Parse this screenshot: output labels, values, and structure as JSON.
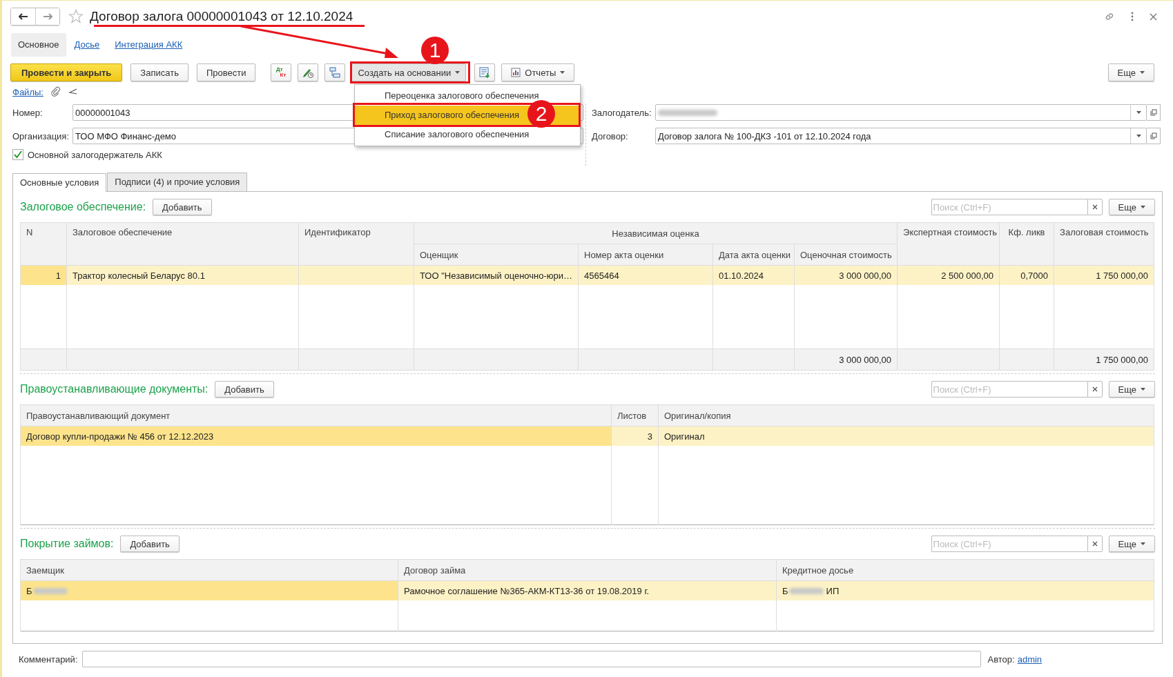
{
  "window": {
    "title": "Договор залога 00000001043 от 12.10.2024"
  },
  "nav_tabs": [
    {
      "label": "Основное",
      "selected": true
    },
    {
      "label": "Досье",
      "selected": false
    },
    {
      "label": "Интеграция АКК",
      "selected": false
    }
  ],
  "toolbar": {
    "buttons": [
      {
        "kind": "primary",
        "label": "Провести и закрыть"
      },
      {
        "kind": "plain",
        "label": "Записать"
      },
      {
        "kind": "plain",
        "label": "Провести"
      },
      {
        "kind": "dtkt",
        "top": "Дт",
        "bottom": "Кт"
      },
      {
        "kind": "pen"
      },
      {
        "kind": "struct"
      },
      {
        "kind": "menu",
        "label": "Создать на основании",
        "expanded": true
      },
      {
        "kind": "doc"
      },
      {
        "kind": "reports",
        "label": "Отчеты"
      }
    ],
    "more": "Еще"
  },
  "create_menu": [
    {
      "label": "Переоценка залогового обеспечения",
      "selected": false
    },
    {
      "label": "Приход залогового обеспечения",
      "selected": true
    },
    {
      "label": "Списание залогового обеспечения",
      "selected": false
    }
  ],
  "files_link": "Файлы:",
  "fields_left": [
    {
      "label": "Номер:",
      "value": "00000001043"
    },
    {
      "label": "Организация:",
      "value": "ТОО МФО Финанс-демо"
    }
  ],
  "fields_right": [
    {
      "label": "Залогодатель:",
      "redacted": true
    },
    {
      "label": "Договор:",
      "value": "Договор залога № 100-ДКЗ -101 от 12.10.2024 года",
      "redacted": false
    }
  ],
  "main_holder": {
    "label": "Основной залогодержатель АКК",
    "checked": true
  },
  "tabs": [
    {
      "label": "Основные условия",
      "selected": true
    },
    {
      "label": "Подписи (4) и прочие условия",
      "selected": false
    }
  ],
  "collateral": {
    "title": "Залоговое обеспечение:",
    "add": "Добавить",
    "search_placeholder": "Поиск (Ctrl+F)",
    "more": "Еще",
    "group_header": "Независимая оценка",
    "columns": [
      "N",
      "Залоговое обеспечение",
      "Идентификатор",
      "Оценщик",
      "Номер акта оценки",
      "Дата акта оценки",
      "Оценочная стоимость",
      "Экспертная стоимость",
      "Кф. ликв",
      "Залоговая стоимость"
    ],
    "rows": [
      {
        "selected": true,
        "cells": [
          "1",
          "Трактор колесный Беларус 80.1",
          "",
          "ТОО \"Независимый оценочно-юри…",
          "4565464",
          "01.10.2024",
          "3 000 000,00",
          "2 500 000,00",
          "0,7000",
          "1 750 000,00"
        ]
      }
    ],
    "totals": {
      "appraised_value": "3 000 000,00",
      "pledge_value": "1 750 000,00"
    }
  },
  "documents": {
    "title": "Правоустанавливающие документы:",
    "add": "Добавить",
    "search_placeholder": "Поиск (Ctrl+F)",
    "more": "Еще",
    "columns": [
      "Правоустанавливающий документ",
      "Листов",
      "Оригинал/копия"
    ],
    "rows": [
      {
        "selected": true,
        "cells": [
          {
            "text": "Договор купли-продажи № 456 от 12.12.2023"
          },
          {
            "text": "3"
          },
          {
            "text": "Оригинал"
          }
        ]
      }
    ]
  },
  "loans": {
    "title": "Покрытие займов:",
    "add": "Добавить",
    "search_placeholder": "Поиск (Ctrl+F)",
    "more": "Еще",
    "columns": [
      "Заемщик",
      "Договор займа",
      "Кредитное досье"
    ],
    "rows": [
      {
        "selected": true,
        "cells": [
          {
            "text": "Б",
            "redacted": true
          },
          {
            "text": "Рамочное соглашение №365-АКМ-КТ13-36 от 19.08.2019 г."
          },
          {
            "text": "Б",
            "redacted": true,
            "suffix": "ИП"
          }
        ]
      }
    ]
  },
  "comment": {
    "label": "Комментарий:"
  },
  "author": {
    "label": "Автор:",
    "value": "admin"
  },
  "annotations": [
    {
      "label": "1"
    },
    {
      "label": "2"
    }
  ]
}
